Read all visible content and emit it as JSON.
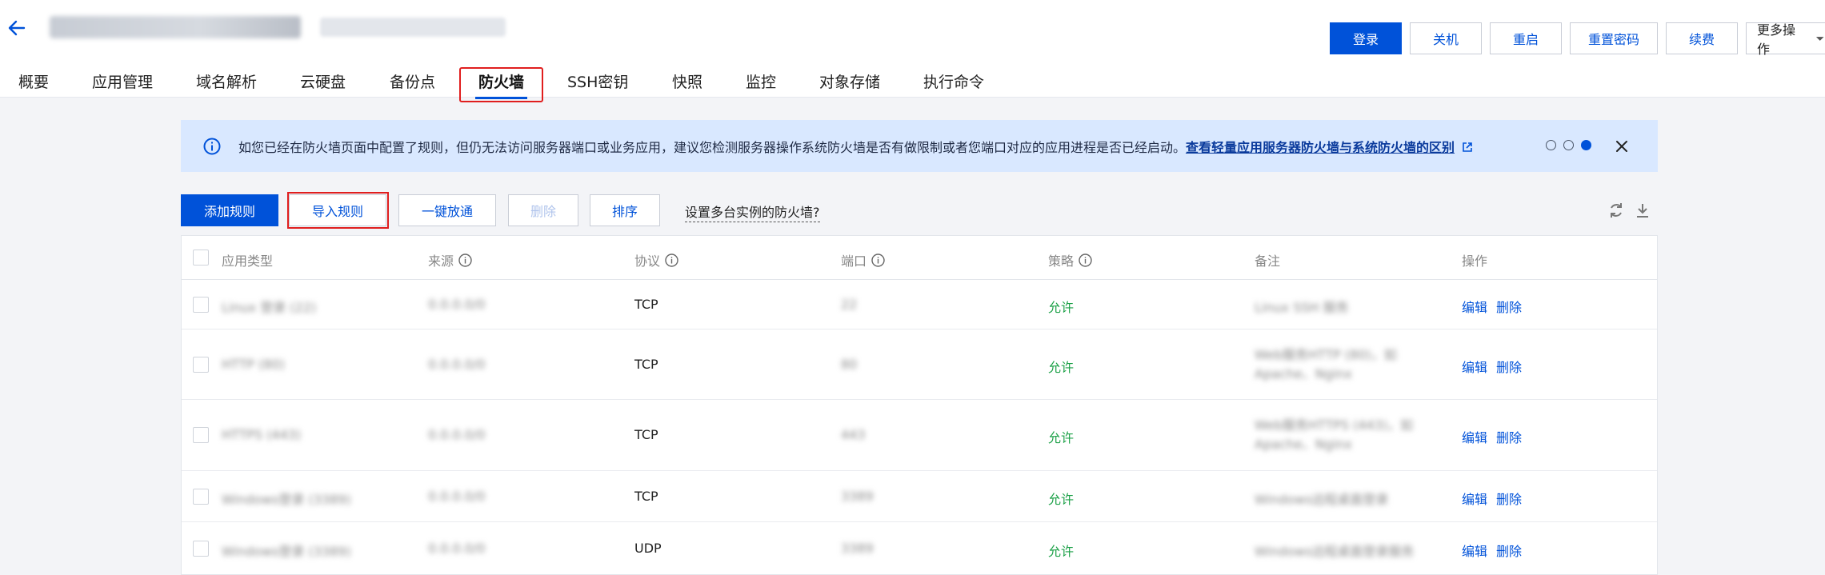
{
  "header": {
    "instance_name": "",
    "subtitle": "",
    "actions": [
      {
        "label": "登录",
        "primary": true
      },
      {
        "label": "关机",
        "primary": false
      },
      {
        "label": "重启",
        "primary": false
      },
      {
        "label": "重置密码",
        "primary": false
      },
      {
        "label": "续费",
        "primary": false
      },
      {
        "label": "更多操作",
        "primary": false
      }
    ]
  },
  "tabs": [
    {
      "label": "概要"
    },
    {
      "label": "应用管理"
    },
    {
      "label": "域名解析"
    },
    {
      "label": "云硬盘"
    },
    {
      "label": "备份点"
    },
    {
      "label": "防火墙",
      "active": true
    },
    {
      "label": "SSH密钥"
    },
    {
      "label": "快照"
    },
    {
      "label": "监控"
    },
    {
      "label": "对象存储"
    },
    {
      "label": "执行命令"
    }
  ],
  "notice": {
    "text": "如您已经在防火墙页面中配置了规则，但仍无法访问服务器端口或业务应用，建议您检测服务器操作系统防火墙是否有做限制或者您端口对应的应用进程是否已经启动。",
    "link": "查看轻量应用服务器防火墙与系统防火墙的区别",
    "page_count": 3,
    "current_page": 3
  },
  "toolbar": {
    "add_rule": "添加规则",
    "import_rules": "导入规则",
    "one_click_allow": "一键放通",
    "delete": "删除",
    "sort": "排序",
    "multi_instance_link": "设置多台实例的防火墙?"
  },
  "table": {
    "columns": {
      "app_type": "应用类型",
      "source": "来源",
      "protocol": "协议",
      "port": "端口",
      "policy": "策略",
      "remark": "备注",
      "operation": "操作"
    },
    "rows": [
      {
        "app_type": "",
        "source": "",
        "protocol": "TCP",
        "port": "",
        "policy": "允许",
        "remark": "",
        "edit": "编辑",
        "delete": "删除"
      },
      {
        "app_type": "",
        "source": "",
        "protocol": "TCP",
        "port": "",
        "policy": "允许",
        "remark": "",
        "edit": "编辑",
        "delete": "删除"
      },
      {
        "app_type": "",
        "source": "",
        "protocol": "TCP",
        "port": "",
        "policy": "允许",
        "remark": "",
        "edit": "编辑",
        "delete": "删除"
      },
      {
        "app_type": "",
        "source": "",
        "protocol": "TCP",
        "port": "",
        "policy": "允许",
        "remark": "",
        "edit": "编辑",
        "delete": "删除"
      },
      {
        "app_type": "",
        "source": "",
        "protocol": "UDP",
        "port": "",
        "policy": "允许",
        "remark": "",
        "edit": "编辑",
        "delete": "删除"
      }
    ]
  },
  "colors": {
    "primary": "#0052d9",
    "allow_green": "#1fa24a",
    "highlight_red": "#e01e1e",
    "notice_bg": "#d9e8ff"
  }
}
